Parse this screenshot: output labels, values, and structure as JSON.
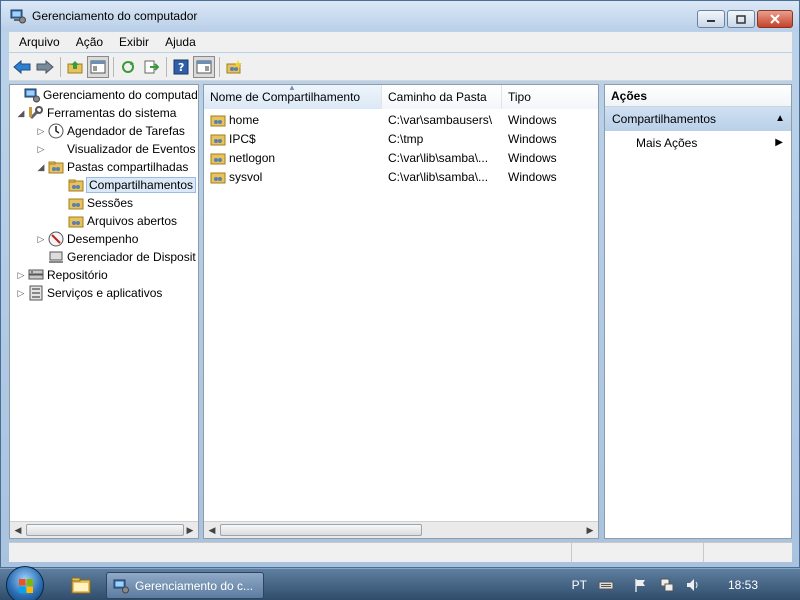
{
  "window": {
    "title": "Gerenciamento do computador"
  },
  "menubar": {
    "items": [
      "Arquivo",
      "Ação",
      "Exibir",
      "Ajuda"
    ]
  },
  "toolbar": {
    "buttons": [
      "back-icon",
      "forward-icon",
      "up-folder-icon",
      "show-hide-tree-icon",
      "refresh-icon",
      "export-list-icon",
      "help-icon",
      "show-hide-action-pane-icon",
      "new-share-icon"
    ]
  },
  "tree": {
    "items": [
      {
        "label": "Gerenciamento do computado",
        "level": 0,
        "expander": ""
      },
      {
        "label": "Ferramentas do sistema",
        "level": 1,
        "expander": "◢"
      },
      {
        "label": "Agendador de Tarefas",
        "level": 2,
        "expander": "▷"
      },
      {
        "label": "Visualizador de Eventos",
        "level": 2,
        "expander": "▷"
      },
      {
        "label": "Pastas compartilhadas",
        "level": 2,
        "expander": "◢"
      },
      {
        "label": "Compartilhamentos",
        "level": 3,
        "expander": "",
        "selected": true
      },
      {
        "label": "Sessões",
        "level": 3,
        "expander": ""
      },
      {
        "label": "Arquivos abertos",
        "level": 3,
        "expander": ""
      },
      {
        "label": "Desempenho",
        "level": 2,
        "expander": "▷"
      },
      {
        "label": "Gerenciador de Disposit",
        "level": 2,
        "expander": ""
      },
      {
        "label": "Repositório",
        "level": 1,
        "expander": "▷"
      },
      {
        "label": "Serviços e aplicativos",
        "level": 1,
        "expander": "▷"
      }
    ]
  },
  "list": {
    "columns": {
      "name": "Nome de Compartilhamento",
      "path": "Caminho da Pasta",
      "type": "Tipo"
    },
    "rows": [
      {
        "name": "home",
        "path": "C:\\var\\sambausers\\",
        "type": "Windows"
      },
      {
        "name": "IPC$",
        "path": "C:\\tmp",
        "type": "Windows"
      },
      {
        "name": "netlogon",
        "path": "C:\\var\\lib\\samba\\...",
        "type": "Windows"
      },
      {
        "name": "sysvol",
        "path": "C:\\var\\lib\\samba\\...",
        "type": "Windows"
      }
    ]
  },
  "actions": {
    "title": "Ações",
    "section": "Compartilhamentos",
    "more": "Mais Ações"
  },
  "taskbar": {
    "task_label": "Gerenciamento do c...",
    "language": "PT",
    "time": "18:53"
  },
  "colors": {
    "selection": "#dbe8f6",
    "accent": "#b9d0e8",
    "taskbar": "#3d5b7c"
  }
}
